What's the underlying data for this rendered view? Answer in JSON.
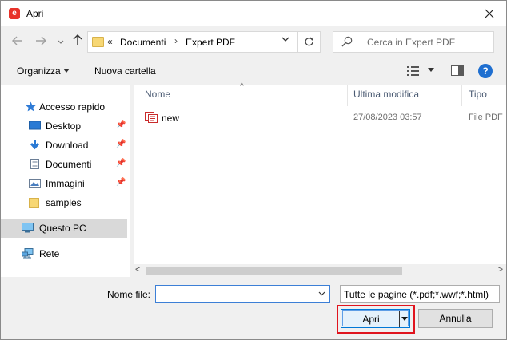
{
  "window": {
    "title": "Apri",
    "app_icon_letter": "e"
  },
  "nav": {
    "address": {
      "prefix": "«",
      "crumbs": [
        "Documenti",
        "Expert PDF"
      ],
      "separator": "›"
    },
    "search_placeholder": "Cerca in Expert PDF"
  },
  "toolbar": {
    "organize_label": "Organizza",
    "new_folder_label": "Nuova cartella"
  },
  "sidebar": {
    "items": [
      {
        "label": "Accesso rapido",
        "icon": "star-icon"
      },
      {
        "label": "Desktop",
        "icon": "desktop-icon",
        "pinned": true
      },
      {
        "label": "Download",
        "icon": "download-icon",
        "pinned": true
      },
      {
        "label": "Documenti",
        "icon": "document-icon",
        "pinned": true
      },
      {
        "label": "Immagini",
        "icon": "image-icon",
        "pinned": true
      },
      {
        "label": "samples",
        "icon": "folder-icon"
      },
      {
        "label": "Questo PC",
        "icon": "computer-icon",
        "selected": true
      },
      {
        "label": "Rete",
        "icon": "network-icon"
      }
    ]
  },
  "content": {
    "columns": {
      "name": "Nome",
      "modified": "Ultima modifica",
      "type": "Tipo"
    },
    "files": [
      {
        "name": "new",
        "modified": "27/08/2023 03:57",
        "type": "File PDF"
      }
    ]
  },
  "footer": {
    "filename_label": "Nome file:",
    "filename_value": "",
    "filetype_value": "Tutte le pagine (*.pdf;*.wwf;*.html)",
    "open_label": "Apri",
    "cancel_label": "Annulla"
  },
  "colors": {
    "accent": "#0078d7",
    "highlight": "#e0141e",
    "app_icon": "#e8332a"
  }
}
